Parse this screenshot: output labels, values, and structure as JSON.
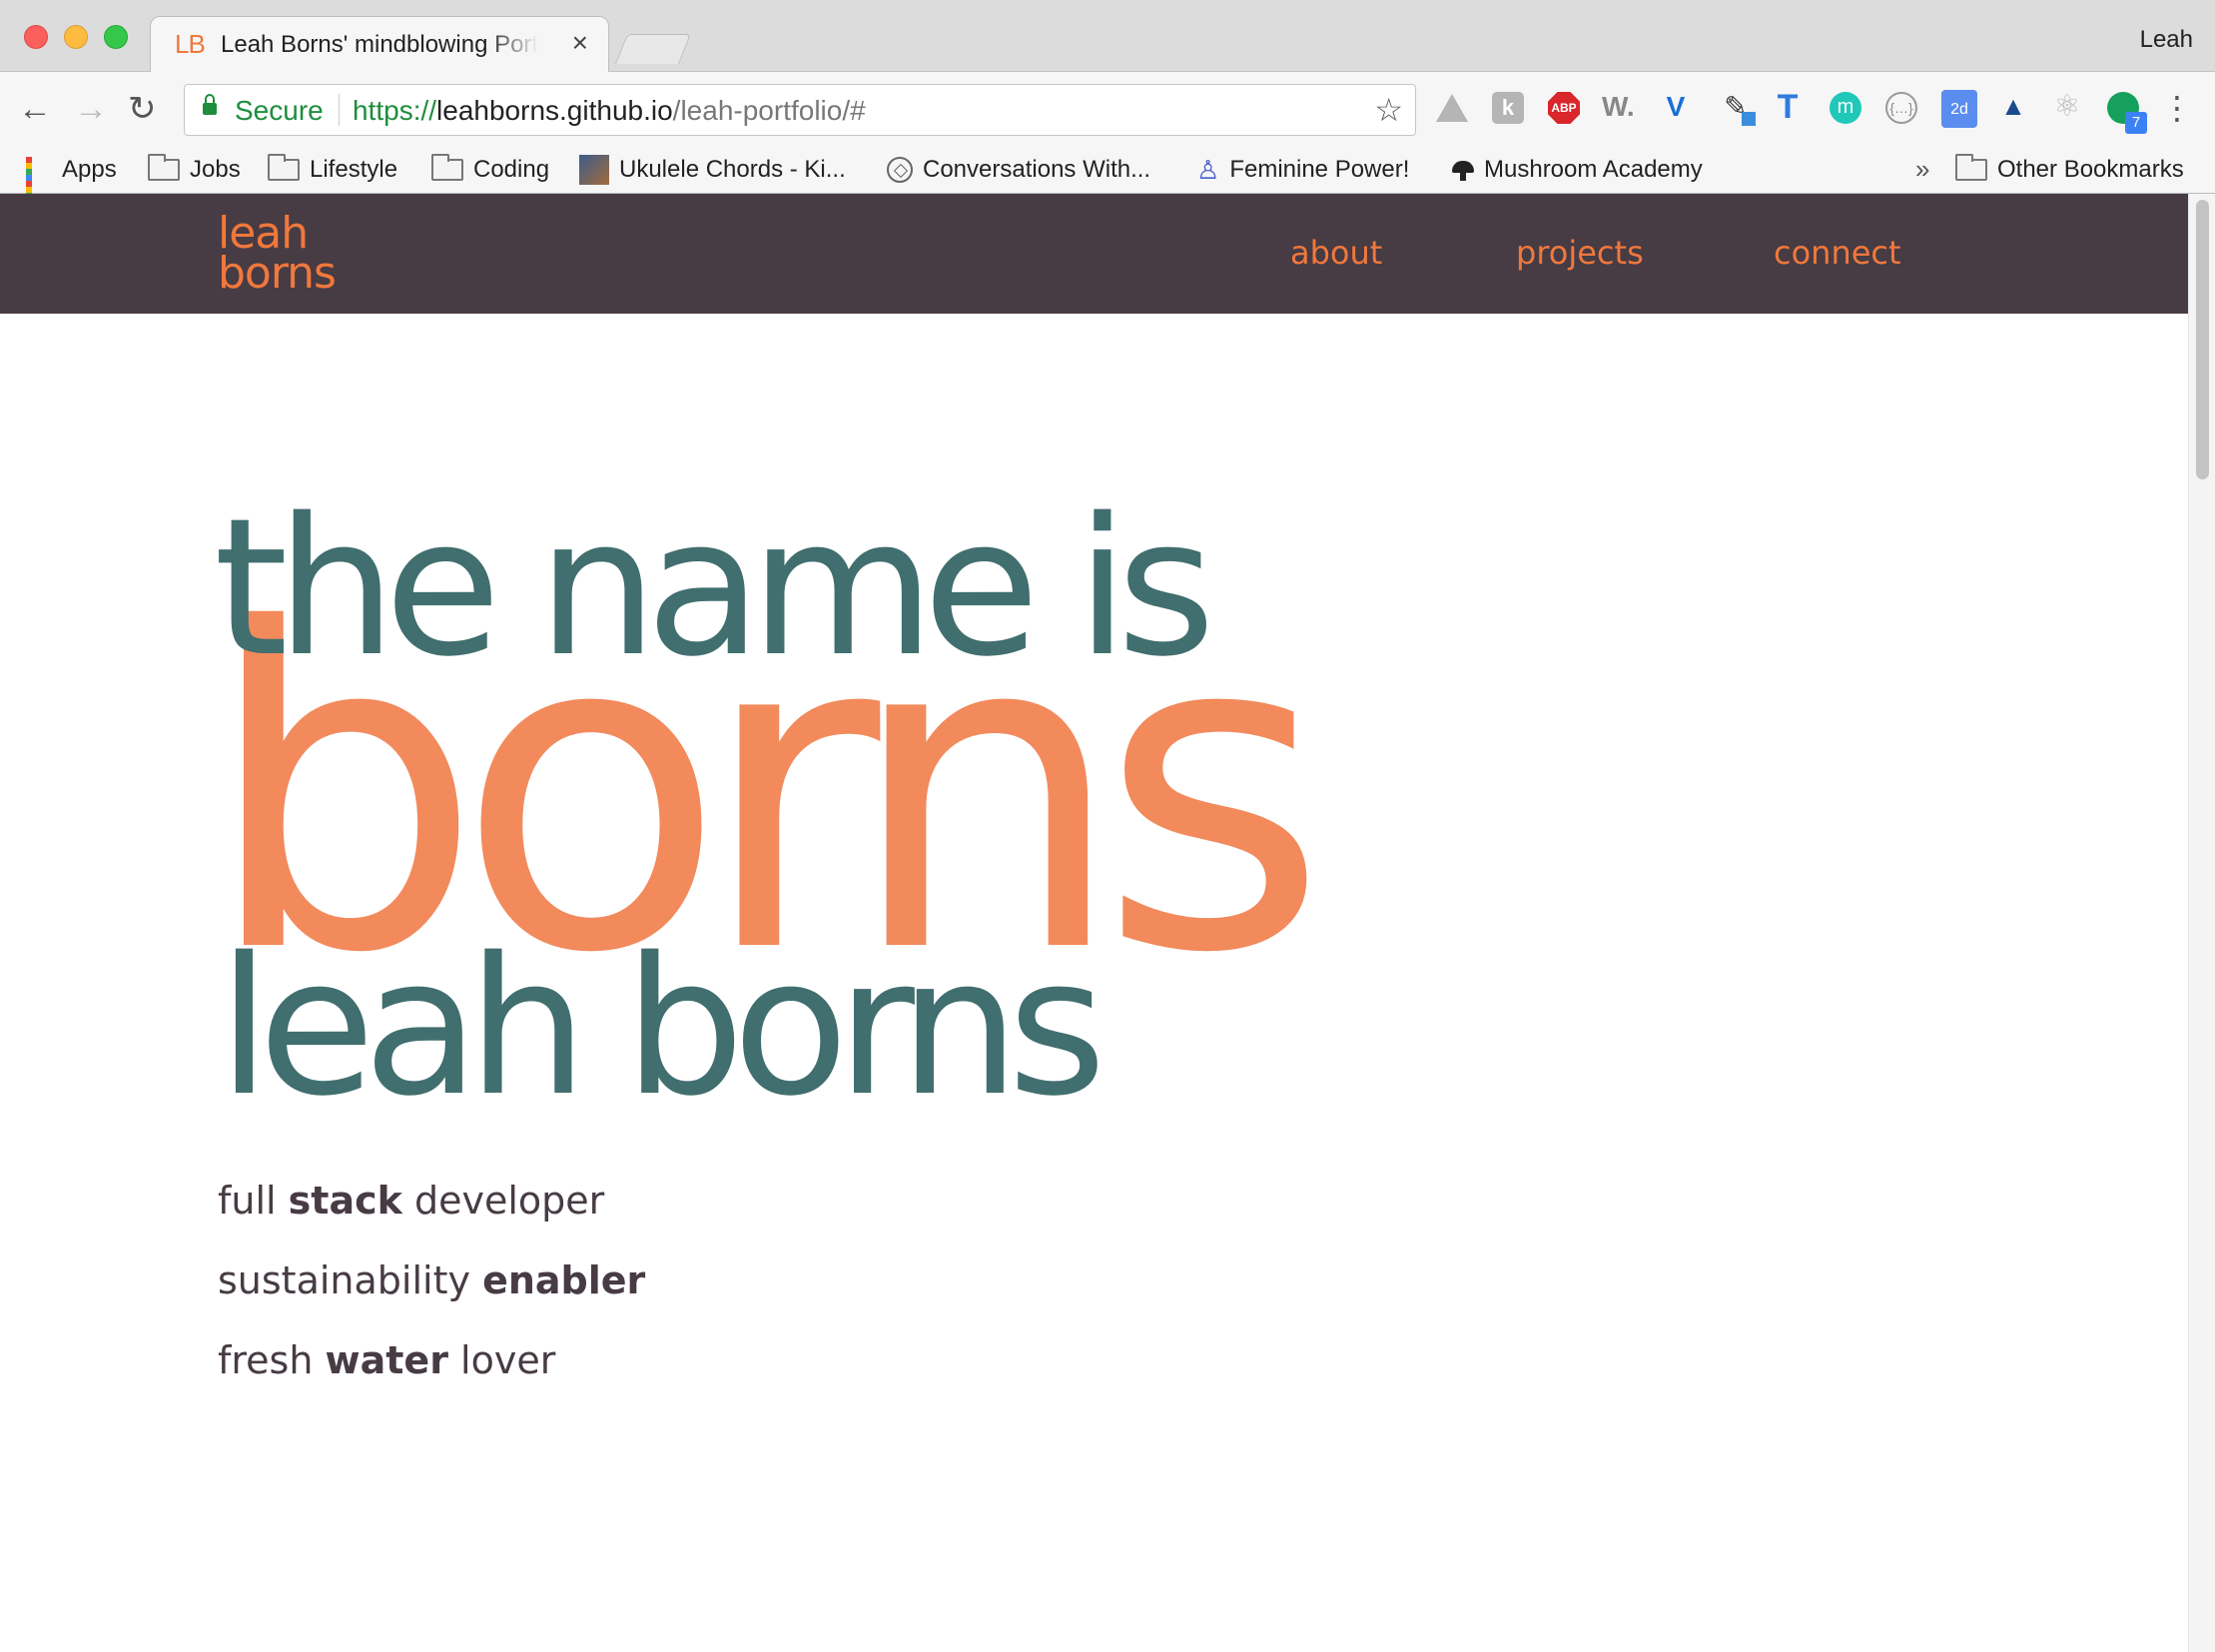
{
  "browser": {
    "tab_title": "Leah Borns' mindblowing Portfolio",
    "tab_favicon": "LB",
    "tab_close": "×",
    "profile_name": "Leah",
    "secure_label": "Secure",
    "url_scheme": "https://",
    "url_host": "leahborns.github.io",
    "url_path": "/leah-portfolio/#",
    "back": "←",
    "forward": "→",
    "reload": "↻",
    "star": "☆",
    "menu": "⋮",
    "extensions": [
      "google-drive-icon",
      "k-extension-icon",
      "adblock-plus-icon",
      "w-extension-icon",
      "v-extension-icon",
      "color-dropper-icon",
      "t-extension-icon",
      "m-extension-icon",
      "json-viewer-icon",
      "2d-extension-icon",
      "axe-icon",
      "react-devtools-icon",
      "grammarly-icon"
    ],
    "ext_labels": {
      "k": "k",
      "abp": "ABP",
      "w": "W.",
      "v": "V",
      "dropper": "✎",
      "t": "T",
      "m": "m",
      "json": "{…}",
      "two_d": "2d",
      "axe": "▲",
      "react": "⚛",
      "g_badge": "7"
    }
  },
  "bookmarks": {
    "items": [
      {
        "label": "Apps",
        "icon": "apps-grid-icon"
      },
      {
        "label": "Jobs",
        "icon": "folder-icon"
      },
      {
        "label": "Lifestyle",
        "icon": "folder-icon"
      },
      {
        "label": "Coding",
        "icon": "folder-icon"
      },
      {
        "label": "Ukulele Chords - Ki...",
        "icon": "photo-icon"
      },
      {
        "label": "Conversations With...",
        "icon": "compass-icon"
      },
      {
        "label": "Feminine Power!",
        "icon": "person-icon"
      },
      {
        "label": "Mushroom Academy",
        "icon": "mushroom-icon"
      }
    ],
    "more": "»",
    "other": "Other Bookmarks"
  },
  "site": {
    "logo_line1": "leah",
    "logo_line2": "borns",
    "nav": [
      "about",
      "projects",
      "connect"
    ],
    "hero_line1": "the name is",
    "hero_big": "borns",
    "hero_line3": "leah borns",
    "taglines": [
      {
        "before": "full ",
        "bold": "stack",
        "after": " developer"
      },
      {
        "before": "sustainability ",
        "bold": "enabler",
        "after": ""
      },
      {
        "before": "fresh ",
        "bold": "water",
        "after": " lover"
      }
    ]
  },
  "colors": {
    "nav_bg": "#473b44",
    "accent_orange": "#f0783c",
    "hero_orange": "#f28a5c",
    "hero_teal": "#416e6e",
    "text_dark": "#473b44"
  }
}
